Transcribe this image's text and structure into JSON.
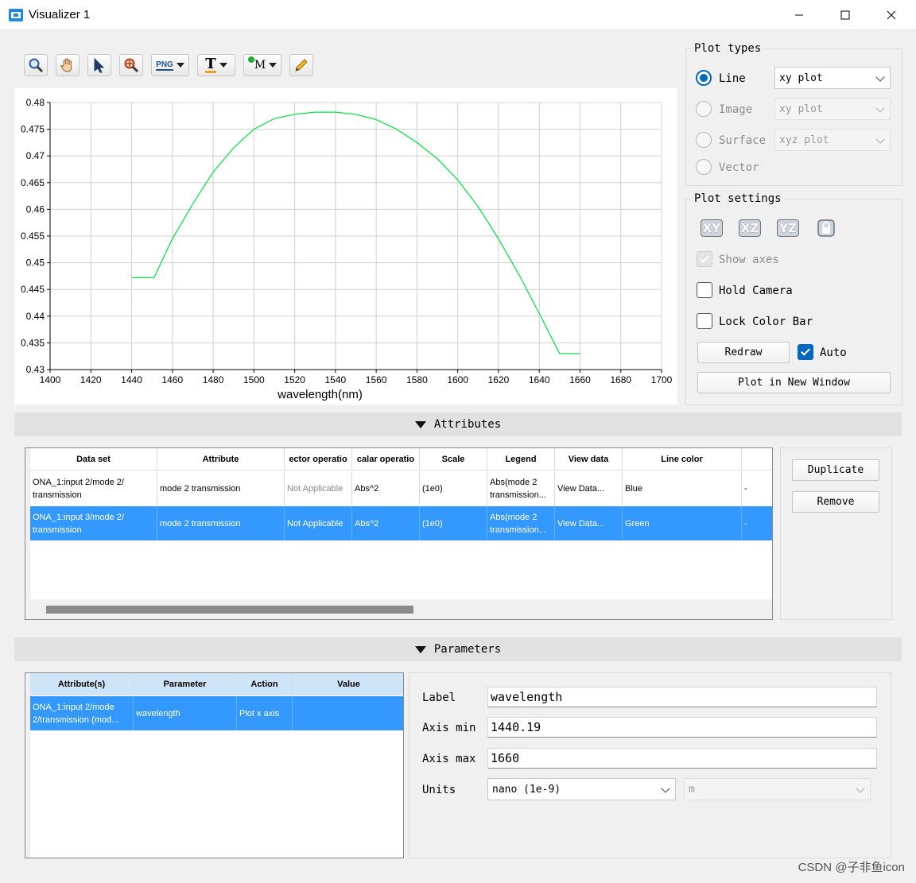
{
  "window": {
    "title": "Visualizer 1"
  },
  "toolbar": {
    "tools": [
      "zoom-icon",
      "pan-hand-icon",
      "select-pointer-icon",
      "zoom-region-icon",
      "png-export-icon",
      "text-icon",
      "marker-icon",
      "pencil-icon"
    ],
    "png_label": "PNG",
    "text_label": "T",
    "marker_label": "M"
  },
  "chart_data": {
    "type": "line",
    "xlabel": "wavelength(nm)",
    "ylabel": "",
    "xlim": [
      1400,
      1700
    ],
    "ylim": [
      0.43,
      0.48
    ],
    "x_ticks": [
      "1400",
      "1420",
      "1440",
      "1460",
      "1480",
      "1500",
      "1520",
      "1540",
      "1560",
      "1580",
      "1600",
      "1620",
      "1640",
      "1660",
      "1680",
      "1700"
    ],
    "y_ticks": [
      "0.48",
      "0.475",
      "0.47",
      "0.465",
      "0.46",
      "0.455",
      "0.45",
      "0.445",
      "0.44",
      "0.435",
      "0.43"
    ],
    "grid": true,
    "series": [
      {
        "color": "#00e040",
        "x": [
          1440.19,
          1451,
          1460,
          1470,
          1480,
          1490,
          1500,
          1510,
          1520,
          1530,
          1540,
          1550,
          1560,
          1570,
          1580,
          1590,
          1600,
          1610,
          1620,
          1630,
          1640,
          1650,
          1660
        ],
        "y": [
          0.4472,
          0.4472,
          0.4545,
          0.461,
          0.467,
          0.4715,
          0.475,
          0.477,
          0.4778,
          0.4782,
          0.4782,
          0.4778,
          0.4768,
          0.475,
          0.4725,
          0.4695,
          0.4655,
          0.4605,
          0.4545,
          0.4478,
          0.4405,
          0.433,
          0.433
        ]
      }
    ]
  },
  "plot_types": {
    "title": "Plot types",
    "options": [
      {
        "label": "Line",
        "combo": "xy plot",
        "selected": true,
        "enabled": true
      },
      {
        "label": "Image",
        "combo": "xy plot",
        "selected": false,
        "enabled": false
      },
      {
        "label": "Surface",
        "combo": "xyz plot",
        "selected": false,
        "enabled": false
      },
      {
        "label": "Vector",
        "combo": "",
        "selected": false,
        "enabled": false
      }
    ]
  },
  "plot_settings": {
    "title": "Plot settings",
    "views": [
      "XY",
      "XZ",
      "YZ"
    ],
    "show_axes": "Show axes",
    "hold_camera": "Hold Camera",
    "lock_color_bar": "Lock Color Bar",
    "redraw": "Redraw",
    "auto": "Auto",
    "plot_new_window": "Plot in New Window"
  },
  "attributes": {
    "title": "Attributes",
    "columns": [
      "Data set",
      "Attribute",
      "ector operatio",
      "calar operatio",
      "Scale",
      "Legend",
      "View data",
      "Line color",
      ""
    ],
    "rows": [
      [
        "ONA_1:input 2/mode 2/ transmission",
        "mode 2 transmission",
        "Not Applicable",
        "Abs^2",
        "(1e0)",
        "Abs(mode 2 transmission...",
        "View Data...",
        "Blue",
        "-"
      ],
      [
        "ONA_1:input 3/mode 2/ transmission",
        "mode 2 transmission",
        "Not Applicable",
        "Abs^2",
        "(1e0)",
        "Abs(mode 2 transmission...",
        "View Data...",
        "Green",
        "-"
      ]
    ],
    "duplicate": "Duplicate",
    "remove": "Remove"
  },
  "parameters": {
    "title": "Parameters",
    "columns": [
      "Attribute(s)",
      "Parameter",
      "Action",
      "Value"
    ],
    "rows": [
      [
        "ONA_1:input 2/mode 2/transmission (mod...",
        "wavelength",
        "Plot x axis",
        ""
      ]
    ],
    "label_label": "Label",
    "label_value": "wavelength",
    "axis_min_label": "Axis min",
    "axis_min_value": "1440.19",
    "axis_max_label": "Axis max",
    "axis_max_value": "1660",
    "units_label": "Units",
    "units_value": "nano (1e-9)",
    "units_base": "m"
  },
  "watermark": "CSDN @子非鱼icon",
  "colors": {
    "selection": "#3399ff",
    "accent": "#0067c0",
    "series": "#00e040"
  }
}
